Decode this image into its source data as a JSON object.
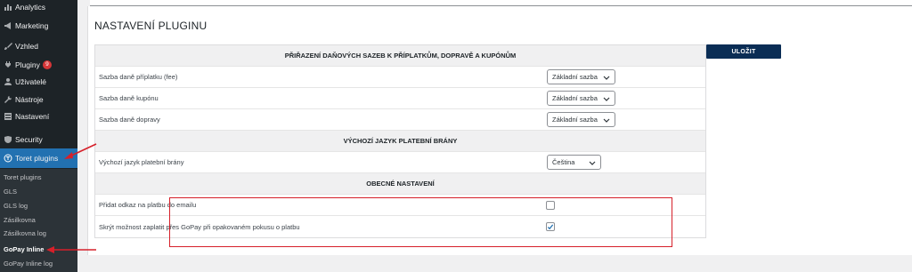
{
  "sidebar": {
    "items": [
      {
        "label": "Analytics",
        "icon": "analytics-icon"
      },
      {
        "label": "Marketing",
        "icon": "megaphone-icon"
      },
      {
        "label": "Vzhled",
        "icon": "brush-icon"
      },
      {
        "label": "Pluginy",
        "icon": "plugin-icon",
        "badge": "9"
      },
      {
        "label": "Uživatelé",
        "icon": "user-icon"
      },
      {
        "label": "Nástroje",
        "icon": "wrench-icon"
      },
      {
        "label": "Nastavení",
        "icon": "settings-icon"
      },
      {
        "label": "Security",
        "icon": "shield-icon"
      },
      {
        "label": "Toret plugins",
        "icon": "toret-logo-icon"
      }
    ],
    "submenu": [
      "Toret plugins",
      "GLS",
      "GLS log",
      "Zásilkovna",
      "Zásilkovna log",
      "GoPay Inline",
      "GoPay Inline log"
    ]
  },
  "page": {
    "title": "NASTAVENÍ PLUGINU",
    "save_label": "ULOŽIT"
  },
  "sections": {
    "tax": {
      "heading": "PŘIŘAZENÍ DAŇOVÝCH SAZEB K PŘÍPLATKŮM, DOPRAVĚ A KUPÓNŮM",
      "rows": [
        {
          "label": "Sazba daně příplatku (fee)",
          "value": "Základní sazba"
        },
        {
          "label": "Sazba daně kupónu",
          "value": "Základní sazba"
        },
        {
          "label": "Sazba daně dopravy",
          "value": "Základní sazba"
        }
      ]
    },
    "language": {
      "heading": "VÝCHOZÍ JAZYK PLATEBNÍ BRÁNY",
      "row": {
        "label": "Výchozí jazyk platební brány",
        "value": "Čeština"
      }
    },
    "general": {
      "heading": "OBECNÉ NASTAVENÍ",
      "rows": [
        {
          "label": "Přidat odkaz na platbu do emailu",
          "checked": false
        },
        {
          "label": "Skrýt možnost zaplatit přes GoPay při opakovaném pokusu o platbu",
          "checked": true
        }
      ]
    }
  },
  "colors": {
    "sidebar_bg": "#1d2327",
    "active_item": "#2271b1",
    "save_button": "#0a2d55",
    "highlight": "#d6202a"
  }
}
